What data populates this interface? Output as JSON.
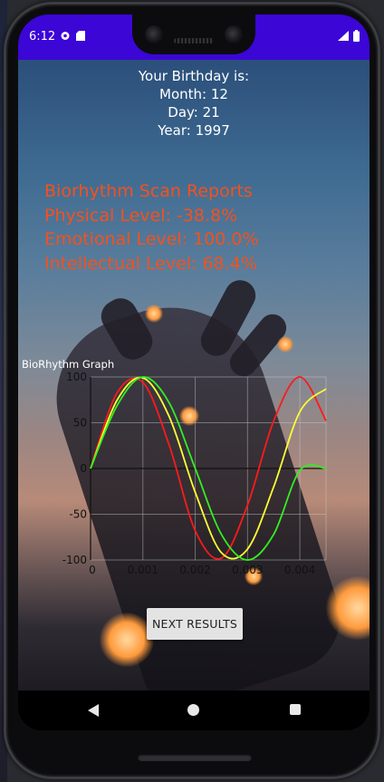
{
  "status_bar": {
    "time": "6:12",
    "background": "#3b06d6"
  },
  "birthday": {
    "heading": "Your Birthday is:",
    "month": "Month: 12",
    "day": "Day: 21",
    "year": "Year: 1997"
  },
  "report": {
    "title": "Biorhythm Scan Reports",
    "physical": "Physical Level: -38.8%",
    "emotional": "Emotional Level: 100.0%",
    "intellectual": "Intellectual Level: 68.4%",
    "color": "#f4511e"
  },
  "graph": {
    "title": "BioRhythm Graph"
  },
  "chart_data": {
    "type": "line",
    "title": "BioRhythm Graph",
    "xlim": [
      0,
      0.0045
    ],
    "ylim": [
      -100,
      100
    ],
    "x_ticks": [
      "0",
      "0.001",
      "0.002",
      "0.003",
      "0.004"
    ],
    "y_ticks": [
      "100",
      "50",
      "0",
      "-50",
      "-100"
    ],
    "grid": true,
    "series": [
      {
        "color": "#ff1a1a",
        "x": [
          0,
          0.0005,
          0.001,
          0.0015,
          0.002,
          0.0025,
          0.003,
          0.0035,
          0.004,
          0.0045
        ],
        "y": [
          0,
          82,
          94,
          26,
          -68,
          -98,
          -40,
          52,
          100,
          52
        ]
      },
      {
        "color": "#ffff33",
        "x": [
          0,
          0.0005,
          0.001,
          0.0015,
          0.002,
          0.0025,
          0.003,
          0.0035,
          0.004,
          0.0045
        ],
        "y": [
          0,
          74,
          99,
          57,
          -26,
          -92,
          -88,
          -20,
          62,
          87
        ]
      },
      {
        "color": "#33ee22",
        "x": [
          0,
          0.0005,
          0.001,
          0.0015,
          0.002,
          0.0025,
          0.003,
          0.0035,
          0.004,
          0.0045
        ],
        "y": [
          0,
          68,
          100,
          72,
          0,
          -72,
          -100,
          -72,
          -2,
          0
        ]
      }
    ]
  },
  "next_button": {
    "label": "NEXT RESULTS"
  }
}
